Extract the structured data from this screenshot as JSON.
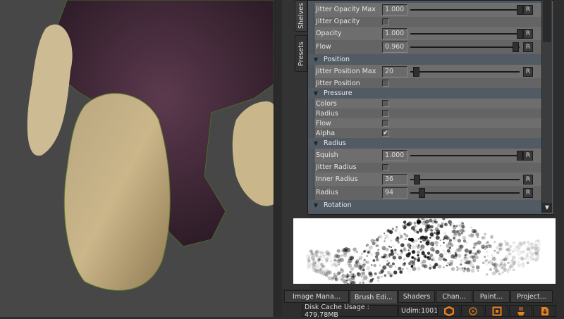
{
  "side_tabs": [
    "Shelves",
    "Presets"
  ],
  "brush_editor": {
    "rows": [
      {
        "type": "slider",
        "label": "Jitter Opacity Max",
        "value": "1.000",
        "fraction": 1.0
      },
      {
        "type": "check",
        "label": "Jitter Opacity",
        "checked": false
      },
      {
        "type": "slider",
        "label": "Opacity",
        "value": "1.000",
        "fraction": 1.0
      },
      {
        "type": "slider",
        "label": "Flow",
        "value": "0.960",
        "fraction": 0.96
      },
      {
        "type": "header",
        "label": "Position"
      },
      {
        "type": "slider",
        "label": "Jitter Position Max",
        "value": "20",
        "fraction": 0.05
      },
      {
        "type": "check",
        "label": "Jitter Position",
        "checked": false
      },
      {
        "type": "header",
        "label": "Pressure"
      },
      {
        "type": "check",
        "label": "Colors",
        "checked": false
      },
      {
        "type": "check",
        "label": "Radius",
        "checked": false
      },
      {
        "type": "check",
        "label": "Flow",
        "checked": false
      },
      {
        "type": "check",
        "label": "Alpha",
        "checked": true
      },
      {
        "type": "header",
        "label": "Radius"
      },
      {
        "type": "slider",
        "label": "Squish",
        "value": "1.000",
        "fraction": 1.0
      },
      {
        "type": "check",
        "label": "Jitter Radius",
        "checked": false
      },
      {
        "type": "slider",
        "label": "Inner Radius",
        "value": "36",
        "fraction": 0.06
      },
      {
        "type": "slider",
        "label": "Radius",
        "value": "94",
        "fraction": 0.1
      },
      {
        "type": "header",
        "label": "Rotation"
      }
    ],
    "reset_label": "R",
    "checkmark": "✔"
  },
  "bottom_tabs": [
    {
      "label": "Image Mana...",
      "active": false
    },
    {
      "label": "Brush Edi...",
      "active": true
    },
    {
      "label": "Shaders",
      "active": false
    },
    {
      "label": "Chan...",
      "active": false
    },
    {
      "label": "Paint...",
      "active": false
    },
    {
      "label": "Project...",
      "active": false
    }
  ],
  "status": {
    "disk_cache": "Disk Cache Usage : 479.78MB",
    "udim": "Udim:1001"
  },
  "status_icons": [
    "hexagon-icon",
    "target-icon",
    "square-dot-icon",
    "steaming-cup-icon",
    "download-file-icon"
  ],
  "colors": {
    "accent": "#e8801e"
  }
}
